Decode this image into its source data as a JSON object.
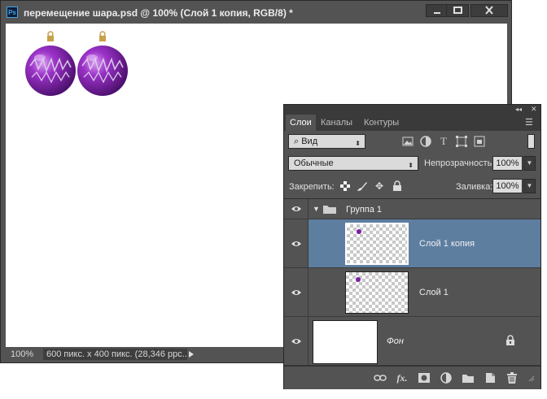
{
  "document": {
    "title": "перемещение шара.psd @ 100% (Слой 1 копия, RGB/8) *",
    "app_badge": "Ps",
    "zoom": "100%",
    "info": "600 пикс. x 400 пикс. (28,346 ppc..."
  },
  "panel": {
    "tabs": [
      {
        "label": "Слои",
        "active": true
      },
      {
        "label": "Каналы",
        "active": false
      },
      {
        "label": "Контуры",
        "active": false
      }
    ],
    "filter": {
      "value": "Вид"
    },
    "blend_mode": "Обычные",
    "opacity_label": "Непрозрачность:",
    "opacity_value": "100%",
    "lock_label": "Закрепить:",
    "fill_label": "Заливка:",
    "fill_value": "100%",
    "layers": [
      {
        "name": "Группа 1",
        "type": "group",
        "visible": true
      },
      {
        "name": "Слой 1 копия",
        "type": "pixel",
        "visible": true,
        "selected": true
      },
      {
        "name": "Слой 1",
        "type": "pixel",
        "visible": true,
        "selected": false
      },
      {
        "name": "Фон",
        "type": "background",
        "visible": true,
        "locked": true
      }
    ]
  },
  "colors": {
    "panel_bg": "#535353",
    "selected_row": "#5e7ea0",
    "ornament": "#8a2bb8"
  },
  "icons": {
    "filter": [
      "image-filter-icon",
      "adjustment-filter-icon",
      "type-filter-icon",
      "shape-filter-icon",
      "smart-object-filter-icon"
    ],
    "lock": [
      "lock-transparent-icon",
      "lock-image-icon",
      "lock-position-icon",
      "lock-all-icon"
    ],
    "bottom": [
      "link-layers-icon",
      "fx-icon",
      "add-mask-icon",
      "new-adjustment-icon",
      "new-group-icon",
      "new-layer-icon",
      "delete-layer-icon"
    ]
  }
}
